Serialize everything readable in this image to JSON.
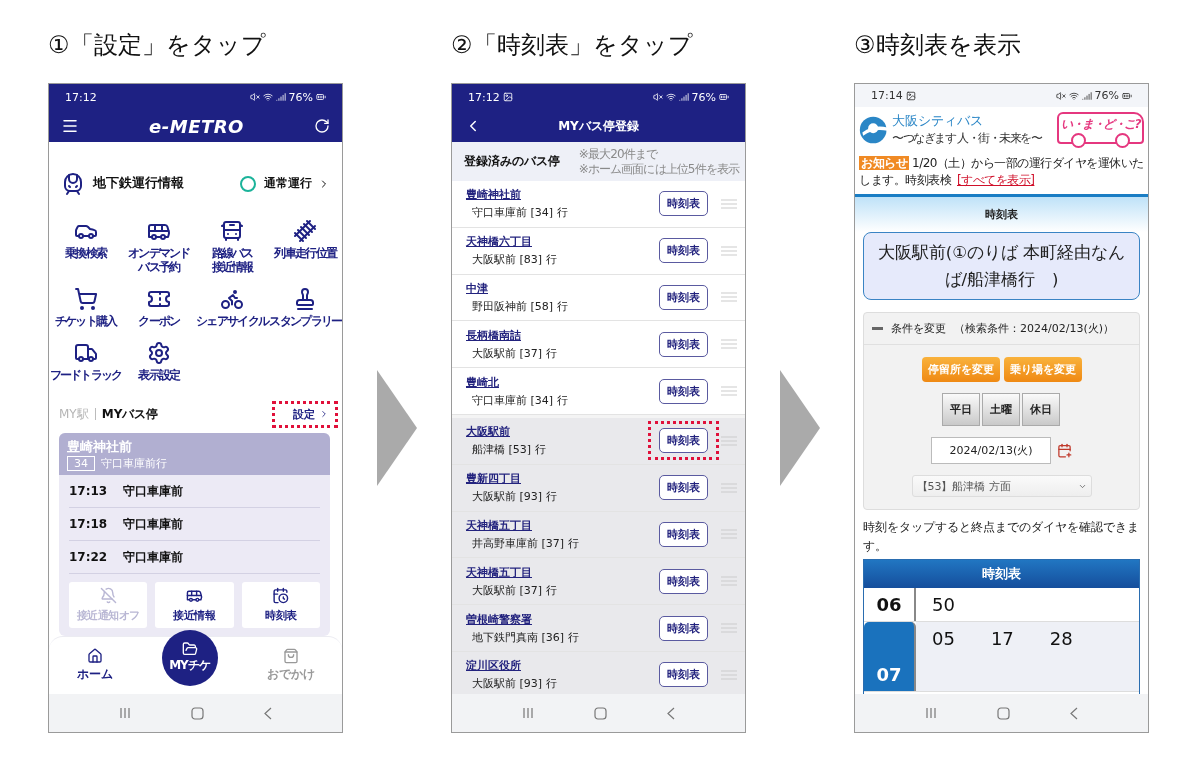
{
  "captions": [
    "①「設定」をタップ",
    "②「時刻表」をタップ",
    "③時刻表を表示"
  ],
  "home_screen": {
    "status_bar": {
      "time": "17:12",
      "battery": "76%"
    },
    "app_title": "e-METRO",
    "subway_status": {
      "label": "地下鉄運行情報",
      "status": "通常運行",
      "color": "#1bb39a"
    },
    "menu": [
      {
        "lines": [
          "乗換検索"
        ]
      },
      {
        "lines": [
          "オンデマンド",
          "バス予約"
        ]
      },
      {
        "lines": [
          "路線バス",
          "接近情報"
        ]
      },
      {
        "lines": [
          "列車走行位置"
        ]
      },
      {
        "lines": [
          "チケット購入"
        ]
      },
      {
        "lines": [
          "クーポン"
        ]
      },
      {
        "lines": [
          "シェアサイクル"
        ]
      },
      {
        "lines": [
          "スタンプラリー"
        ]
      },
      {
        "lines": [
          "フードトラック"
        ]
      },
      {
        "lines": [
          "表示設定"
        ]
      }
    ],
    "tabs": [
      {
        "label": "MY駅",
        "selected": false
      },
      {
        "label": "MYバス停",
        "selected": true
      }
    ],
    "settings_link": {
      "label": "設定",
      "highlighted": true
    },
    "stop_card": {
      "name": "豊崎神社前",
      "route": "34",
      "destination": "守口車庫前行",
      "departures": [
        {
          "time": "17:13",
          "destination": "守口車庫前"
        },
        {
          "time": "17:18",
          "destination": "守口車庫前"
        },
        {
          "time": "17:22",
          "destination": "守口車庫前"
        }
      ],
      "actions": [
        {
          "label": "接近通知オフ",
          "disabled": true
        },
        {
          "label": "接近情報",
          "disabled": false
        },
        {
          "label": "時刻表",
          "disabled": false
        }
      ]
    },
    "bottom_nav": [
      {
        "label": "ホーム",
        "kind": "tab",
        "selected": true
      },
      {
        "label": "MYチケ",
        "kind": "center",
        "selected": false
      },
      {
        "label": "おでかけ",
        "kind": "tab",
        "selected": false
      }
    ]
  },
  "bus_stop_screen": {
    "status_bar": {
      "time": "17:12",
      "battery": "76%"
    },
    "title": "MYバス停登録",
    "section": {
      "label": "登録済みのバス停",
      "notes": [
        "※最大20件まで",
        "※ホーム画面には上位5件を表示"
      ]
    },
    "stops": [
      {
        "name": "豊崎神社前",
        "destination": "守口車庫前 [34] 行",
        "button": "時刻表",
        "on_home": true,
        "highlighted": false
      },
      {
        "name": "天神橋六丁目",
        "destination": "大阪駅前 [83] 行",
        "button": "時刻表",
        "on_home": true,
        "highlighted": false
      },
      {
        "name": "中津",
        "destination": "野田阪神前 [58] 行",
        "button": "時刻表",
        "on_home": true,
        "highlighted": false
      },
      {
        "name": "長柄橋南詰",
        "destination": "大阪駅前 [37] 行",
        "button": "時刻表",
        "on_home": true,
        "highlighted": false
      },
      {
        "name": "豊崎北",
        "destination": "守口車庫前 [34] 行",
        "button": "時刻表",
        "on_home": true,
        "highlighted": false
      },
      {
        "name": "大阪駅前",
        "destination": "船津橋 [53] 行",
        "button": "時刻表",
        "on_home": false,
        "highlighted": true
      },
      {
        "name": "豊新四丁目",
        "destination": "大阪駅前 [93] 行",
        "button": "時刻表",
        "on_home": false,
        "highlighted": false
      },
      {
        "name": "天神橋五丁目",
        "destination": "井高野車庫前 [37] 行",
        "button": "時刻表",
        "on_home": false,
        "highlighted": false
      },
      {
        "name": "天神橋五丁目",
        "destination": "大阪駅前 [37] 行",
        "button": "時刻表",
        "on_home": false,
        "highlighted": false
      },
      {
        "name": "曽根崎警察署",
        "destination": "地下鉄門真南 [36] 行",
        "button": "時刻表",
        "on_home": false,
        "highlighted": false
      },
      {
        "name": "淀川区役所",
        "destination": "大阪駅前 [93] 行",
        "button": "時刻表",
        "on_home": false,
        "highlighted": false
      }
    ]
  },
  "timetable_screen": {
    "status_bar": {
      "time": "17:14",
      "battery": "76%"
    },
    "brand": {
      "name": "大阪シティバス",
      "tagline": "〜つなぎます 人・街・未来を〜",
      "badge_logo": "い・ま・ど・こ?"
    },
    "notice": {
      "badge": "お知らせ",
      "text": "1/20（土）から一部の運行ダイヤを運休いたします。時刻表検",
      "link": "[すべてを表示]"
    },
    "section_title": "時刻表",
    "stop_title": "大阪駅前(①のりば 本町経由なんば/船津橋行　)",
    "conditions": {
      "toggle": "条件を変更",
      "summary": "（検索条件：2024/02/13(火)）",
      "expanded": true,
      "buttons": [
        "停留所を変更",
        "乗り場を変更"
      ],
      "day_types": [
        "平日",
        "土曜",
        "休日"
      ],
      "date": "2024/02/13(火)",
      "route": "【53】船津橋 方面"
    },
    "hint": "時刻をタップすると終点までのダイヤを確認できます。",
    "timetable": {
      "title": "時刻表",
      "rows": [
        {
          "hour": "06",
          "minutes": [
            "50"
          ],
          "selected": false
        },
        {
          "hour": "07",
          "minutes": [
            "05",
            "17",
            "28"
          ],
          "selected": true
        }
      ]
    }
  }
}
